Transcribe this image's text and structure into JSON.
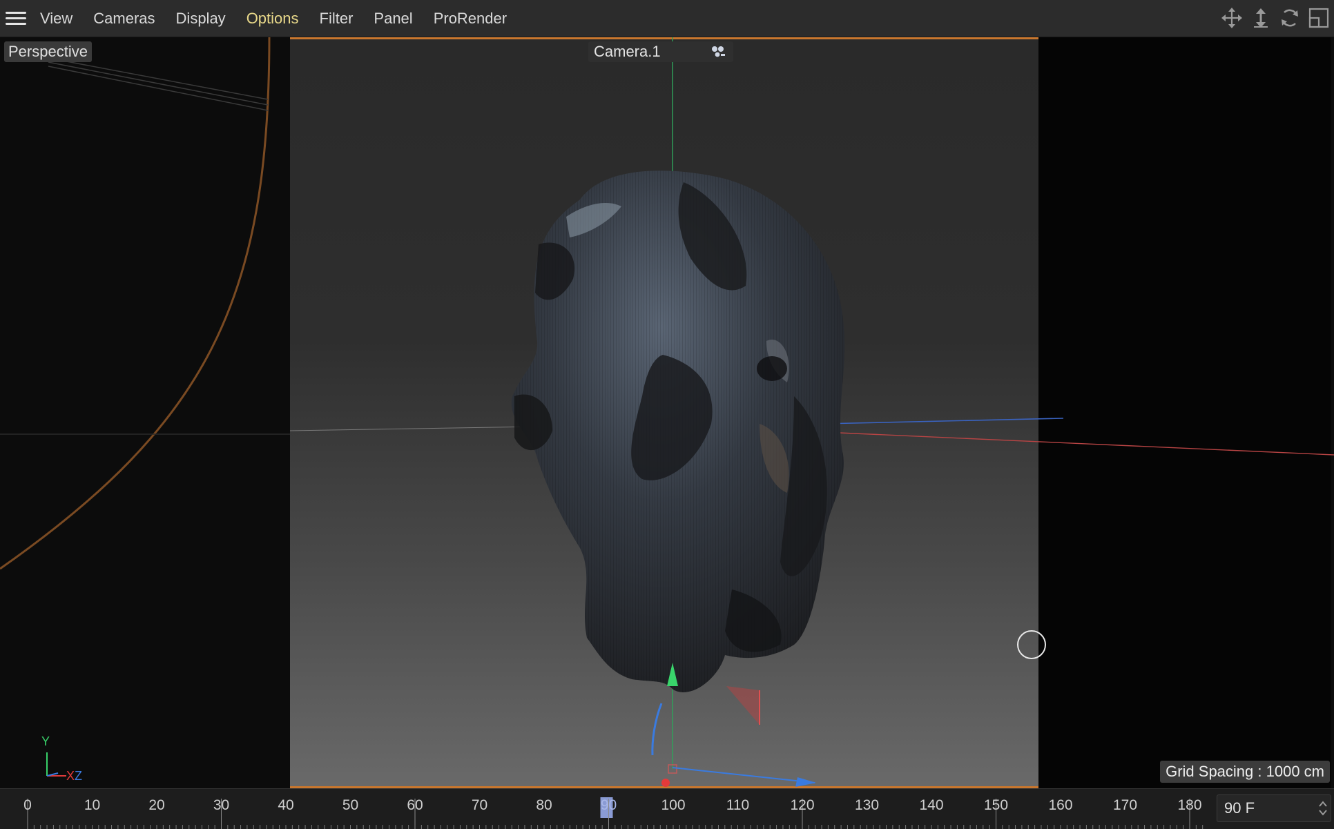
{
  "menubar": {
    "items": [
      {
        "label": "View"
      },
      {
        "label": "Cameras"
      },
      {
        "label": "Display"
      },
      {
        "label": "Options",
        "active": true
      },
      {
        "label": "Filter"
      },
      {
        "label": "Panel"
      },
      {
        "label": "ProRender"
      }
    ],
    "nav_icons": [
      "move-icon",
      "dolly-icon",
      "rotate-icon",
      "maximize-icon"
    ]
  },
  "viewport": {
    "label": "Perspective",
    "camera_name": "Camera.1",
    "grid_spacing": "Grid Spacing : 1000 cm",
    "axis": {
      "y": "Y",
      "x": "X",
      "z": "Z"
    }
  },
  "timeline": {
    "ticks": [
      0,
      10,
      20,
      30,
      40,
      50,
      60,
      70,
      80,
      90,
      100,
      110,
      120,
      130,
      140,
      150,
      160,
      170,
      180
    ],
    "current_frame": "90",
    "frame_field": "90 F"
  },
  "colors": {
    "accent_orange": "#c9772e",
    "active_menu": "#e9d98a",
    "axis_x": "#e03a3a",
    "axis_y": "#38d26a",
    "axis_z": "#3a7be0",
    "playhead": "#8a9bd4"
  }
}
